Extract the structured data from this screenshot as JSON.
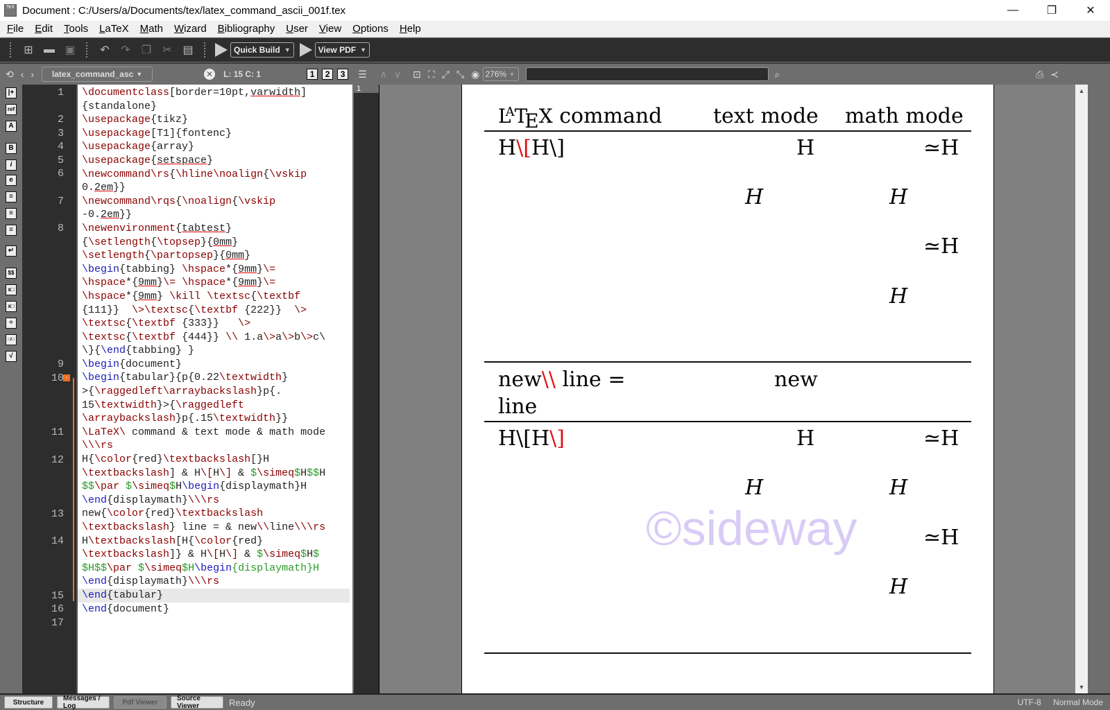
{
  "window": {
    "title": "Document : C:/Users/a/Documents/tex/latex_command_ascii_001f.tex",
    "controls": {
      "minimize": "—",
      "restore": "❐",
      "close": "✕"
    }
  },
  "menu": [
    "File",
    "Edit",
    "Tools",
    "LaTeX",
    "Math",
    "Wizard",
    "Bibliography",
    "User",
    "View",
    "Options",
    "Help"
  ],
  "toolbar": {
    "icons": [
      "new-file-icon",
      "open-file-icon",
      "save-icon",
      "undo-icon",
      "redo-icon",
      "copy-icon",
      "cut-icon",
      "paste-icon"
    ],
    "quick_build": "Quick Build",
    "view_pdf": "View PDF"
  },
  "editor_bar": {
    "file_tab": "latex_command_asc",
    "cursor": "L: 15 C: 1",
    "layout_buttons": [
      "1",
      "2",
      "3"
    ],
    "zoom": "276%",
    "search_placeholder": ""
  },
  "sidebar_icons": [
    "|+",
    "ref",
    "A",
    "B",
    "i",
    "e",
    "≡",
    "≡",
    "≡",
    "↵",
    "$$",
    "x□",
    "x□",
    "÷",
    "□/□",
    "√"
  ],
  "gutter": {
    "line_numbers": [
      {
        "n": "1"
      },
      {
        "n": "2"
      },
      {
        "n": "3"
      },
      {
        "n": "4"
      },
      {
        "n": "5"
      },
      {
        "n": "6"
      },
      {
        "n": "7"
      },
      {
        "n": "8"
      },
      {
        "n": "9"
      },
      {
        "n": "10"
      },
      {
        "n": "11"
      },
      {
        "n": "12"
      },
      {
        "n": "13"
      },
      {
        "n": "14"
      },
      {
        "n": "15"
      },
      {
        "n": "16"
      },
      {
        "n": "17"
      }
    ],
    "fold_marker": "-"
  },
  "code_lines": [
    "\\documentclass[border=10pt,varwidth]",
    "{standalone}",
    "\\usepackage{tikz}",
    "\\usepackage[T1]{fontenc}",
    "\\usepackage{array}",
    "\\usepackage{setspace}",
    "\\newcommand\\rs{\\hline\\noalign{\\vskip",
    "0.2em}}",
    "\\newcommand\\rqs{\\noalign{\\vskip",
    "-0.2em}}",
    "\\newenvironment{tabtest}",
    "{\\setlength{\\topsep}{0mm}",
    "\\setlength{\\partopsep}{0mm}",
    "\\begin{tabbing} \\hspace*{9mm}\\=",
    "\\hspace*{9mm}\\= \\hspace*{9mm}\\=",
    "\\hspace*{9mm} \\kill \\textsc{\\textbf",
    "{111}}  \\>\\textsc{\\textbf {222}}  \\>",
    "\\textsc{\\textbf {333}}   \\>",
    "\\textsc{\\textbf {444}} \\\\ 1.a\\>a\\>b\\>c\\",
    "\\}{\\end{tabbing} }",
    "\\begin{document}",
    "\\begin{tabular}{p{0.22\\textwidth}",
    ">{\\raggedleft\\arraybackslash}p{.",
    "15\\textwidth}>{\\raggedleft",
    "\\arraybackslash}p{.15\\textwidth}}",
    "\\LaTeX\\ command & text mode & math mode",
    "\\\\\\rs",
    "H{\\color{red}\\textbackslash[}H",
    "\\textbackslash] & H\\[H\\] & $\\simeq$H$$H",
    "$$\\par $\\simeq$H\\begin{displaymath}H",
    "\\end{displaymath}\\\\\\rs",
    "new{\\color{red}\\textbackslash",
    "\\textbackslash} line = & new\\\\line\\\\\\rs",
    "H\\textbackslash[H{\\color{red}",
    "\\textbackslash]} & H\\[H\\] & $\\simeq$H$",
    "$H$$\\par $\\simeq$H\\begin{displaymath}H",
    "\\end{displaymath}\\\\\\rs",
    "\\end{tabular}",
    "\\end{document}"
  ],
  "pdf": {
    "page_number": "1",
    "header": {
      "col1_logo": "LATEX",
      "col1_rest": "command",
      "col2": "text mode",
      "col3": "math mode"
    },
    "row1": {
      "c1a": "H",
      "c1b": "\\[",
      "c1c": "H\\]",
      "t1": "H",
      "m1": "≃H",
      "t2": "H",
      "m2": "H",
      "m3": "≃H",
      "m4": "H"
    },
    "row2": {
      "c1a": "new",
      "c1b": "\\\\",
      "c1c": " line =",
      "c1d": "line",
      "t1": "new"
    },
    "row3": {
      "c1a": "H\\[H",
      "c1b": "\\]",
      "t1": "H",
      "m1": "≃H",
      "t2": "H",
      "m2": "H",
      "m3": "≃H",
      "m4": "H"
    },
    "watermark": "©sideway"
  },
  "statusbar": {
    "tabs": [
      "Structure",
      "Messages / Log",
      "Pdf Viewer",
      "Source Viewer"
    ],
    "state": "Ready",
    "encoding": "UTF-8",
    "mode": "Normal Mode"
  }
}
